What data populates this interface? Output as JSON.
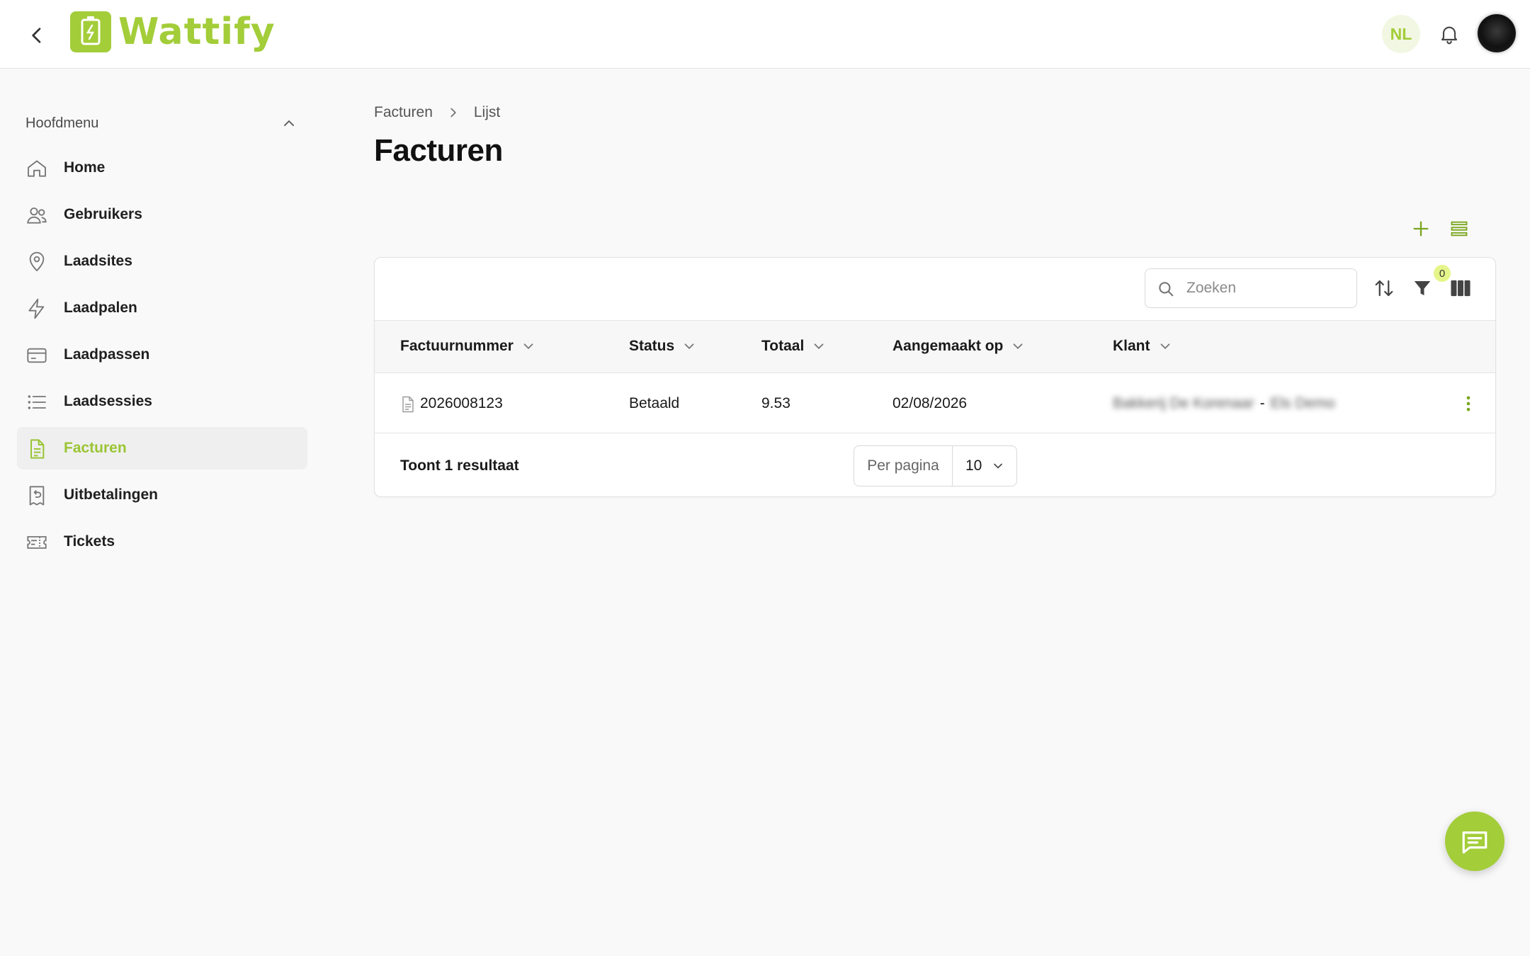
{
  "header": {
    "brand": "Wattify",
    "language": "NL",
    "accent_color": "#a3cd39"
  },
  "sidebar": {
    "title": "Hoofdmenu",
    "items": [
      {
        "label": "Home",
        "icon": "home-icon",
        "active": false
      },
      {
        "label": "Gebruikers",
        "icon": "users-icon",
        "active": false
      },
      {
        "label": "Laadsites",
        "icon": "map-pin-icon",
        "active": false
      },
      {
        "label": "Laadpalen",
        "icon": "lightning-icon",
        "active": false
      },
      {
        "label": "Laadpassen",
        "icon": "card-icon",
        "active": false
      },
      {
        "label": "Laadsessies",
        "icon": "list-icon",
        "active": false
      },
      {
        "label": "Facturen",
        "icon": "invoice-icon",
        "active": true
      },
      {
        "label": "Uitbetalingen",
        "icon": "receipt-refund-icon",
        "active": false
      },
      {
        "label": "Tickets",
        "icon": "ticket-icon",
        "active": false
      }
    ]
  },
  "breadcrumb": {
    "parent": "Facturen",
    "current": "Lijst"
  },
  "page": {
    "title": "Facturen"
  },
  "toolbar": {
    "search_placeholder": "Zoeken",
    "filter_count": "0"
  },
  "table": {
    "columns": [
      "Factuurnummer",
      "Status",
      "Totaal",
      "Aangemaakt op",
      "Klant"
    ],
    "rows": [
      {
        "factuurnummer": "2026008123",
        "status": "Betaald",
        "totaal": "9.53",
        "aangemaakt_op": "02/08/2026",
        "klant_name": "Bakkerij De Korenaar",
        "klant_sep": "-",
        "klant_contact": "Els Demo"
      }
    ]
  },
  "footer": {
    "result_text": "Toont 1 resultaat",
    "per_page_label": "Per pagina",
    "per_page_value": "10"
  }
}
